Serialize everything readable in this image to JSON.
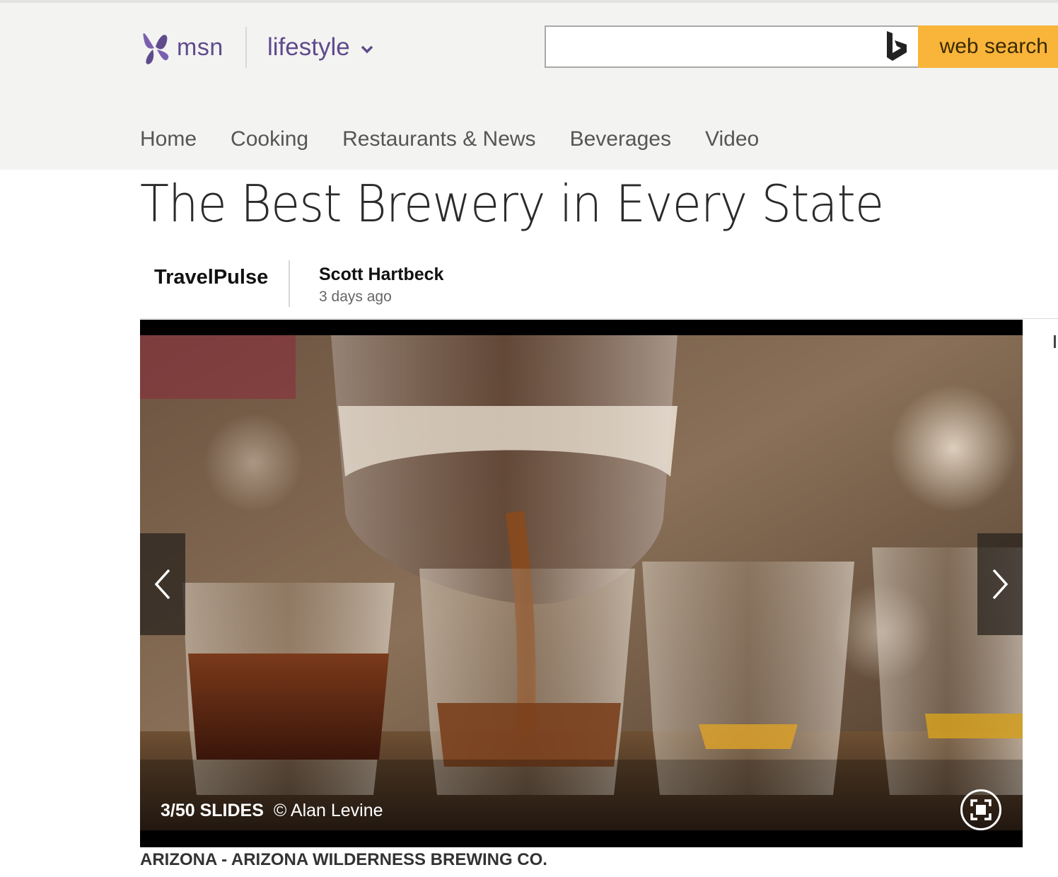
{
  "header": {
    "logo_text": "msn",
    "section_label": "lifestyle",
    "search": {
      "value": "",
      "placeholder": "",
      "button_label": "web search"
    },
    "nav_items": [
      "Home",
      "Cooking",
      "Restaurants & News",
      "Beverages",
      "Video"
    ],
    "brand_color": "#5f4b8b",
    "search_button_color": "#f9b43a"
  },
  "article": {
    "title": "The Best Brewery in Every State",
    "source": "TravelPulse",
    "author": "Scott Hartbeck",
    "timestamp": "3 days ago"
  },
  "slideshow": {
    "counter": "3/50 SLIDES",
    "credit": "© Alan Levine",
    "caption": "ARIZONA - ARIZONA WILDERNESS BREWING CO.",
    "image_alt": "Beer being poured from a pitcher into a row of small tasting glasses",
    "icons": [
      "chevron-left-icon",
      "chevron-right-icon",
      "fullscreen-icon"
    ]
  }
}
